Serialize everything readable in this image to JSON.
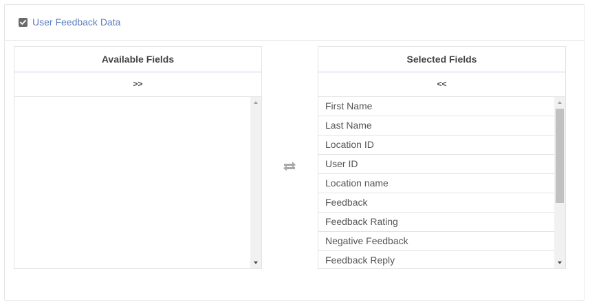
{
  "header": {
    "checkbox_checked": true,
    "label": "User Feedback Data"
  },
  "available": {
    "title": "Available Fields",
    "action_label": ">>",
    "items": []
  },
  "selected": {
    "title": "Selected Fields",
    "action_label": "<<",
    "items": [
      "First Name",
      "Last Name",
      "Location ID",
      "User ID",
      "Location name",
      "Feedback",
      "Feedback Rating",
      "Negative Feedback",
      "Feedback Reply"
    ]
  },
  "icons": {
    "transfer": "swap-arrows-icon",
    "checkbox": "checkmark-icon"
  },
  "colors": {
    "link": "#5b7fbf",
    "checkbox": "#6b6b6b",
    "icon": "#a8a8a8"
  }
}
